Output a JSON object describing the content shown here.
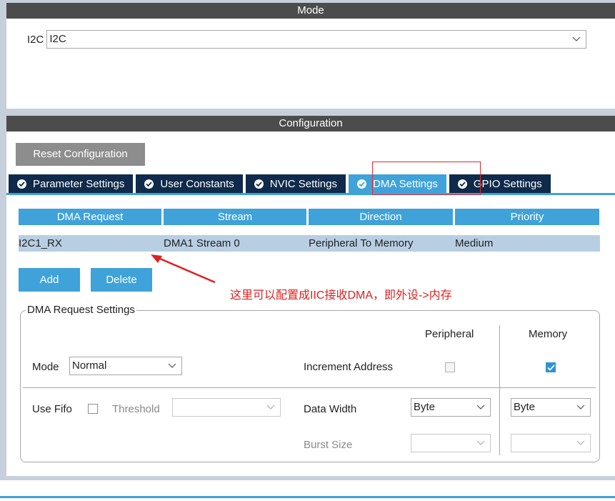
{
  "mode": {
    "header": "Mode",
    "i2c_label": "I2C",
    "i2c_value": "I2C"
  },
  "config": {
    "header": "Configuration",
    "reset_label": "Reset Configuration",
    "tabs": [
      {
        "label": "Parameter Settings"
      },
      {
        "label": "User Constants"
      },
      {
        "label": "NVIC Settings"
      },
      {
        "label": "DMA Settings"
      },
      {
        "label": "GPIO Settings"
      }
    ],
    "active_tab": "DMA Settings",
    "table": {
      "headers": [
        "DMA Request",
        "Stream",
        "Direction",
        "Priority"
      ],
      "rows": [
        [
          "I2C1_RX",
          "DMA1 Stream 0",
          "Peripheral To Memory",
          "Medium"
        ]
      ]
    },
    "add_label": "Add",
    "delete_label": "Delete",
    "annotation": "这里可以配置成IIC接收DMA，即外设->内存",
    "request_settings": {
      "title": "DMA Request Settings",
      "peripheral_label": "Peripheral",
      "memory_label": "Memory",
      "mode_label": "Mode",
      "mode_value": "Normal",
      "increment_label": "Increment Address",
      "peripheral_increment": false,
      "memory_increment": true,
      "use_fifo_label": "Use Fifo",
      "use_fifo": false,
      "threshold_label": "Threshold",
      "threshold_value": "",
      "data_width_label": "Data Width",
      "peripheral_width": "Byte",
      "memory_width": "Byte",
      "burst_size_label": "Burst Size",
      "peripheral_burst": "",
      "memory_burst": ""
    }
  },
  "colors": {
    "accent": "#3fa2d9",
    "tab_dark": "#0f2a4a",
    "header_bg": "#4c4c4c",
    "annotation": "#e02020"
  }
}
